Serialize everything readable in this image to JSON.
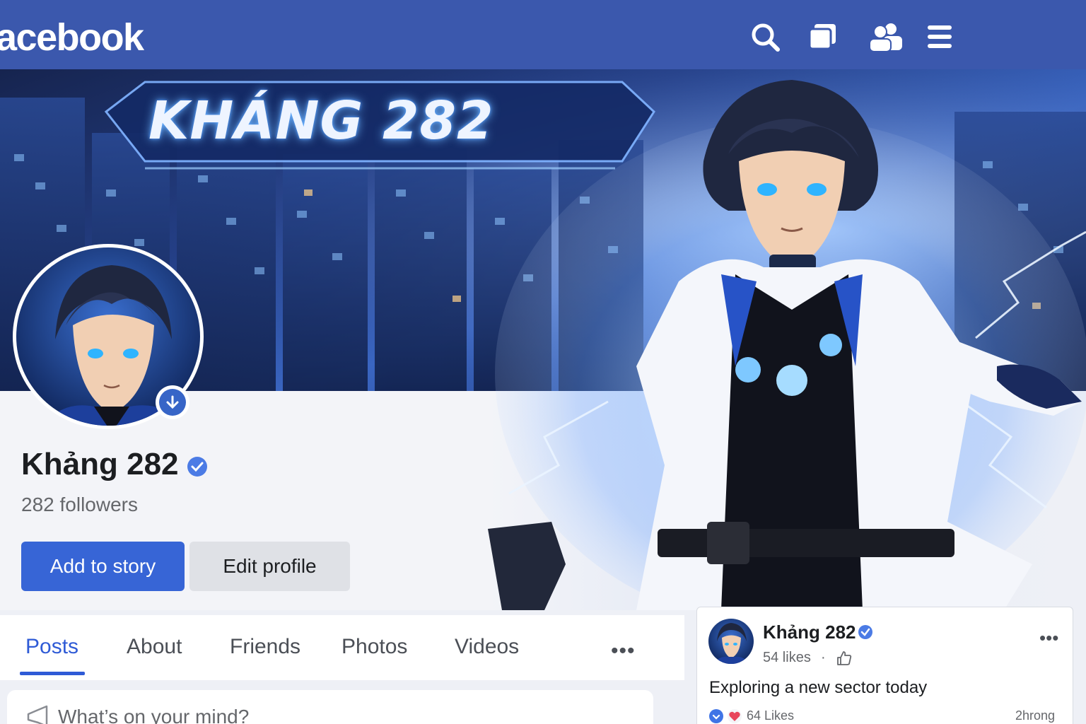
{
  "header": {
    "logo": "acebook",
    "icons": [
      "search-icon",
      "messenger-icon",
      "friends-icon",
      "menu-icon"
    ]
  },
  "cover": {
    "banner_text": "KHÁNG 282"
  },
  "profile": {
    "name": "Khảng 282",
    "followers": "282 followers",
    "add_story_label": "Add to story",
    "edit_profile_label": "Edit profile"
  },
  "tabs": {
    "items": [
      "Posts",
      "About",
      "Friends",
      "Photos",
      "Videos"
    ],
    "active": "Posts",
    "more": "•••"
  },
  "composer": {
    "placeholder": "What’s on your mind?"
  },
  "post": {
    "author": "Khảng 282",
    "meta_likes": "54 likes",
    "meta_dot": "·",
    "text": "Exploring a new sector today",
    "reactions": "64 Likes",
    "time": "2hrong",
    "more": "•••"
  },
  "colors": {
    "brand_bar": "#3b58ad",
    "primary_button": "#3765d6",
    "secondary_button": "#dfe1e6",
    "active_tab": "#2f5bd6"
  }
}
